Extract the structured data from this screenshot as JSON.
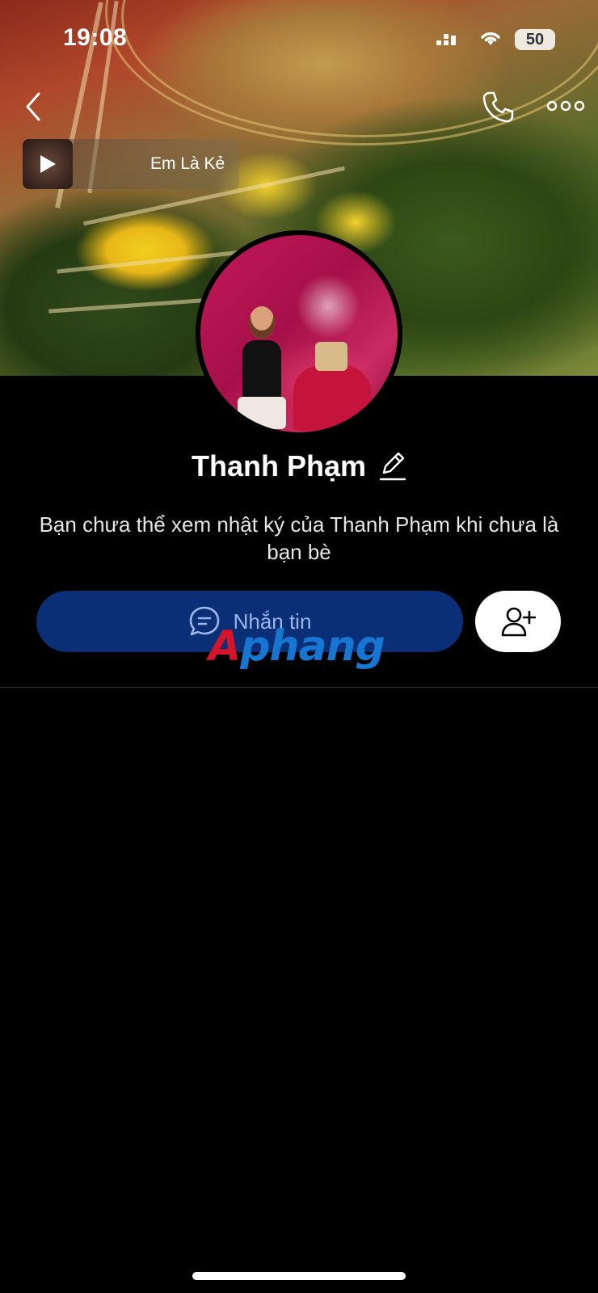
{
  "status_bar": {
    "time": "19:08",
    "battery": "50"
  },
  "music": {
    "title": "Em Là Kẻ"
  },
  "profile": {
    "name": "Thanh Phạm",
    "notice": "Bạn chưa thể xem nhật ký của Thanh Phạm khi chưa là bạn bè"
  },
  "actions": {
    "message_label": "Nhắn tin"
  },
  "watermark": {
    "first": "A",
    "rest": "phang"
  },
  "colors": {
    "message_button": "#0a2f76",
    "background": "#000000"
  }
}
